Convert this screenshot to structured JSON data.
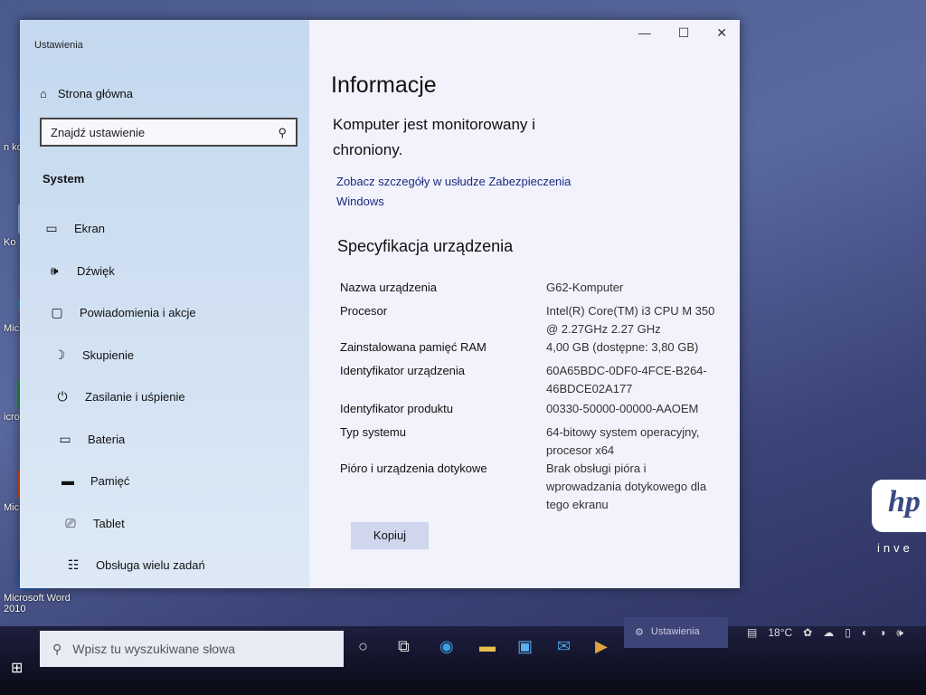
{
  "desktop": {
    "icons": [
      {
        "label": "n kon",
        "icon": "control-panel-icon"
      },
      {
        "label": "Ko",
        "icon": "recycle-bin-icon"
      },
      {
        "label": "Microso",
        "icon": "edge-icon"
      },
      {
        "label": "icrosoft E",
        "icon": "excel-icon"
      },
      {
        "label": "Micro PowerPo",
        "icon": "powerpoint-icon"
      },
      {
        "label": "Microsoft Word 2010",
        "icon": "word-icon"
      }
    ],
    "brand": "hp",
    "brand_sub": "inve"
  },
  "window": {
    "app_title": "Ustawienia",
    "controls": {
      "minimize": "—",
      "maximize": "☐",
      "close": "✕"
    },
    "sidebar": {
      "home": "Strona główna",
      "search_placeholder": "Znajdź ustawienie",
      "section": "System",
      "items": [
        {
          "label": "Ekran",
          "icon": "monitor-icon",
          "glyph": "▭"
        },
        {
          "label": "Dźwięk",
          "icon": "speaker-icon",
          "glyph": "🕪"
        },
        {
          "label": "Powiadomienia i akcje",
          "icon": "notification-icon",
          "glyph": "▢"
        },
        {
          "label": "Skupienie",
          "icon": "moon-icon",
          "glyph": "☽"
        },
        {
          "label": "Zasilanie i uśpienie",
          "icon": "power-icon",
          "glyph": "⏻"
        },
        {
          "label": "Bateria",
          "icon": "battery-icon",
          "glyph": "▭"
        },
        {
          "label": "Pamięć",
          "icon": "storage-icon",
          "glyph": "▬"
        },
        {
          "label": "Tablet",
          "icon": "tablet-icon",
          "glyph": "⎚"
        },
        {
          "label": "Obsługa wielu zadań",
          "icon": "multitasking-icon",
          "glyph": "☷"
        }
      ]
    },
    "main": {
      "title": "Informacje",
      "protection": "Komputer jest monitorowany i chroniony.",
      "security_link": "Zobacz szczegóły w usłudze Zabezpieczenia Windows",
      "spec_title": "Specyfikacja urządzenia",
      "specs": [
        {
          "label": "Nazwa urządzenia",
          "value": "G62-Komputer"
        },
        {
          "label": "Procesor",
          "value": "Intel(R) Core(TM) i3 CPU M 350 @ 2.27GHz 2.27 GHz"
        },
        {
          "label": "Zainstalowana pamięć RAM",
          "value": "4,00 GB (dostępne: 3,80 GB)"
        },
        {
          "label": "Identyfikator urządzenia",
          "value": "60A65BDC-0DF0-4FCE-B264-46BDCE02A177"
        },
        {
          "label": "Identyfikator produktu",
          "value": "00330-50000-00000-AAOEM"
        },
        {
          "label": "Typ systemu",
          "value": "64-bitowy system operacyjny, procesor x64"
        },
        {
          "label": "Pióro i urządzenia dotykowe",
          "value": "Brak obsługi pióra i wprowadzania dotykowego dla tego ekranu"
        }
      ],
      "copy_button": "Kopiuj"
    }
  },
  "taskbar": {
    "search_placeholder": "Wpisz tu wyszukiwane słowa",
    "open_app": "Ustawienia",
    "weather": "18°C"
  }
}
